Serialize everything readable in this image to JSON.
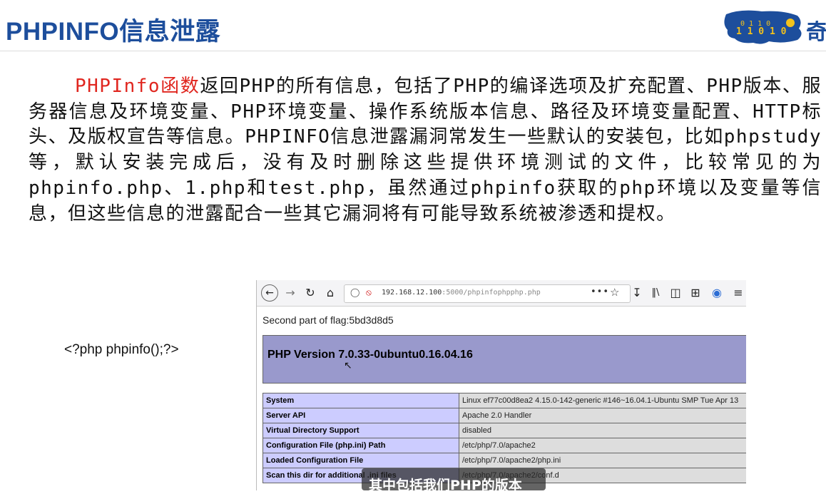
{
  "slide": {
    "title": "PHPINFO信息泄露",
    "logo_text": "奇",
    "paragraph_highlight": "PHPInfo函数",
    "paragraph_rest": "返回PHP的所有信息，包括了PHP的编译选项及扩充配置、PHP版本、服务器信息及环境变量、PHP环境变量、操作系统版本信息、路径及环境变量配置、HTTP标头、及版权宣告等信息。PHPINFO信息泄露漏洞常发生一些默认的安装包，比如phpstudy等，默认安装完成后，没有及时删除这些提供环境测试的文件，比较常见的为phpinfo.php、1.php和test.php，虽然通过phpinfo获取的php环境以及变量等信息，但这些信息的泄露配合一些其它漏洞将有可能导致系统被渗透和提权。",
    "code_note": "<?php phpinfo();?>"
  },
  "browser": {
    "url_host": "192.168.12.100",
    "url_port": ":5000",
    "url_path": "/phpinfophpphp.php",
    "icons": [
      "back-icon",
      "forward-icon",
      "reload-icon",
      "home-icon",
      "shield-icon",
      "insecure-lock-icon",
      "more-icon",
      "star-icon",
      "download-icon",
      "library-icon",
      "sidebar-icon",
      "screenshot-icon",
      "extension-icon",
      "menu-icon"
    ],
    "flag_text": "Second part of flag:5bd3d8d5",
    "php_version": "PHP Version 7.0.33-0ubuntu0.16.04.16",
    "rows": [
      {
        "key": "System",
        "value": "Linux ef77c00d8ea2 4.15.0-142-generic #146~16.04.1-Ubuntu SMP Tue Apr 13"
      },
      {
        "key": "Server API",
        "value": "Apache 2.0 Handler"
      },
      {
        "key": "Virtual Directory Support",
        "value": "disabled"
      },
      {
        "key": "Configuration File (php.ini) Path",
        "value": "/etc/php/7.0/apache2"
      },
      {
        "key": "Loaded Configuration File",
        "value": "/etc/php/7.0/apache2/php.ini"
      },
      {
        "key": "Scan this dir for additional .ini files",
        "value": "/etc/php/7.0/apache2/conf.d"
      }
    ]
  },
  "subtitle": "其中包括我们PHP的版本",
  "colors": {
    "title": "#1d4e9c",
    "highlight": "#e0261f",
    "php_header": "#9999cc",
    "table_key": "#ccccff",
    "table_value": "#dddddd"
  }
}
